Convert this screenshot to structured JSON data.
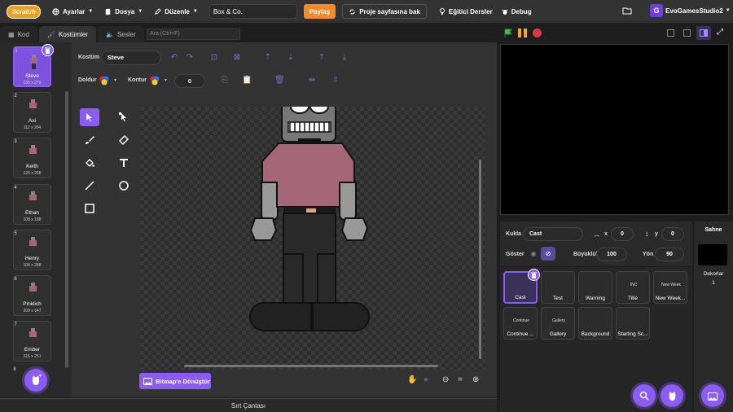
{
  "menubar": {
    "logo": "Scratch",
    "settings": "Ayarlar",
    "file": "Dosya",
    "edit": "Düzenle",
    "project_title": "Box & Co.",
    "share": "Paylaş",
    "see_project_page": "Proje sayfasına bak",
    "tutorials": "Eğitici Dersler",
    "debug": "Debug",
    "username": "EvoGamesStudio2"
  },
  "tabs": {
    "code": "Kod",
    "costumes": "Kostümler",
    "sounds": "Sesler",
    "search_placeholder": "Ara (Ctrl+F)"
  },
  "costumes": [
    {
      "num": "1",
      "name": "Steve",
      "dims": "135 x 279",
      "selected": true
    },
    {
      "num": "2",
      "name": "Axi",
      "dims": "112 x 264"
    },
    {
      "num": "3",
      "name": "Keith",
      "dims": "120 x 258"
    },
    {
      "num": "4",
      "name": "Ethan",
      "dims": "108 x 188"
    },
    {
      "num": "5",
      "name": "Henry",
      "dims": "106 x 288"
    },
    {
      "num": "6",
      "name": "Pinklich",
      "dims": "209 x 147"
    },
    {
      "num": "7",
      "name": "Ember",
      "dims": "215 x 251"
    },
    {
      "num": "8",
      "name": "",
      "dims": ""
    }
  ],
  "editor": {
    "costume_label": "Kostüm",
    "costume_name": "Steve",
    "fill_label": "Doldur",
    "outline_label": "Kontur",
    "outline_value": "0",
    "convert_button": "Bitmap'e Dönüştür"
  },
  "backpack": "Sırt Çantası",
  "sprite_info": {
    "sprite_label": "Kukla",
    "sprite_name": "Cast",
    "x_label": "x",
    "x_value": "0",
    "y_label": "y",
    "y_value": "0",
    "show_label": "Göster",
    "size_label": "Büyüklük",
    "size_value": "100",
    "direction_label": "Yön",
    "direction_value": "90"
  },
  "sprites": [
    {
      "name": "Cast",
      "selected": true,
      "thumb": ""
    },
    {
      "name": "Test",
      "thumb": ""
    },
    {
      "name": "Warning",
      "thumb": ""
    },
    {
      "name": "Title",
      "thumb": "INC"
    },
    {
      "name": "New Week...",
      "thumb": "New Week"
    },
    {
      "name": "Continue ...",
      "thumb": "Continue"
    },
    {
      "name": "Gallery",
      "thumb": "Gallery"
    },
    {
      "name": "Background",
      "thumb": ""
    },
    {
      "name": "Starting Sc...",
      "thumb": ""
    }
  ],
  "stage_panel": {
    "title": "Sahne",
    "backdrops_label": "Dekorlar",
    "backdrops_count": "1"
  },
  "colors": {
    "accent": "#8b5cf6",
    "shirt": "#a56678",
    "share": "#f28a2a"
  }
}
